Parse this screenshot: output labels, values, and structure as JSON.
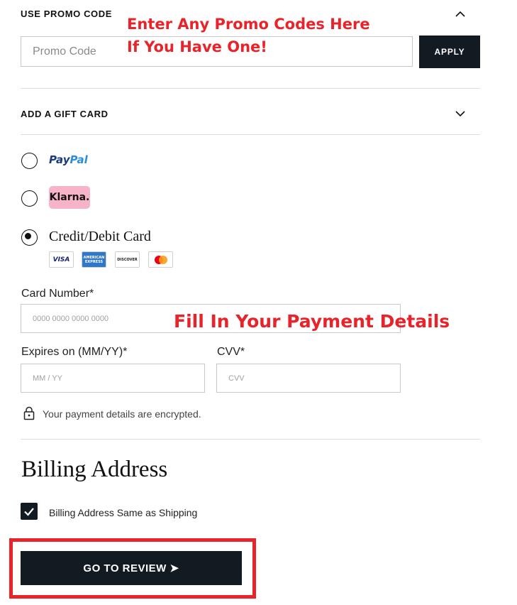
{
  "promo": {
    "title": "USE PROMO CODE",
    "placeholder": "Promo Code",
    "apply_label": "APPLY",
    "annotation_line1": "Enter Any Promo Codes Here",
    "annotation_line2": "If You Have One!"
  },
  "gift_card": {
    "title": "ADD A GIFT CARD"
  },
  "payment_methods": {
    "paypal": {
      "pay": "Pay",
      "pal": "Pal",
      "selected": false
    },
    "klarna": {
      "label": "Klarna.",
      "selected": false
    },
    "card": {
      "label": "Credit/Debit Card",
      "selected": true,
      "brands": {
        "visa": "VISA",
        "amex_line1": "AMERICAN",
        "amex_line2": "EXPRESS",
        "discover": "DISCOVER"
      }
    }
  },
  "card_form": {
    "card_number_label": "Card Number*",
    "card_number_placeholder": "0000 0000 0000 0000",
    "annotation": "Fill In Your Payment Details",
    "expiry_label": "Expires on (MM/YY)*",
    "expiry_placeholder": "MM / YY",
    "cvv_label": "CVV*",
    "cvv_placeholder": "CVV",
    "encrypted_note": "Your payment details are encrypted."
  },
  "billing": {
    "title": "Billing Address",
    "same_as_shipping_label": "Billing Address Same as Shipping",
    "same_as_shipping_checked": true
  },
  "review": {
    "label": "GO TO REVIEW ➤"
  },
  "colors": {
    "dark": "#121a22",
    "annotation_red": "#e8232a",
    "klarna_pink": "#f7b3c8",
    "paypal_dark_blue": "#1b3a82",
    "paypal_light_blue": "#2a8fd6"
  }
}
